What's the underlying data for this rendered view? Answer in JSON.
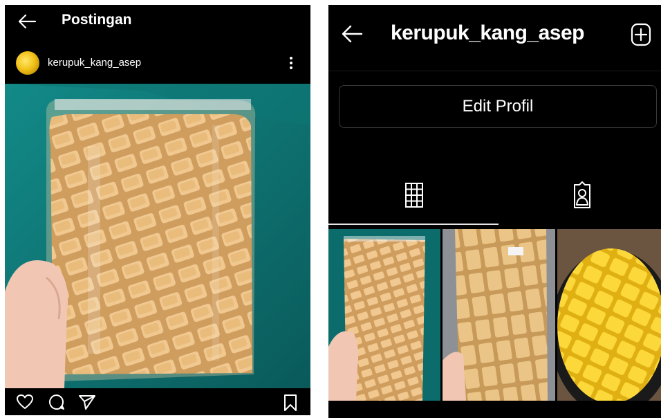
{
  "left": {
    "header": {
      "title": "Postingan"
    },
    "post": {
      "username": "kerupuk_kang_asep"
    },
    "icons": {
      "back": "arrow-left-icon",
      "more": "more-vertical-icon",
      "like": "heart-icon",
      "comment": "comment-icon",
      "share": "send-icon",
      "save": "bookmark-icon"
    }
  },
  "right": {
    "header": {
      "username": "kerupuk_kang_asep"
    },
    "edit_profile_label": "Edit Profil",
    "tabs": [
      {
        "icon": "grid-icon",
        "active": true
      },
      {
        "icon": "tagged-user-icon",
        "active": false
      }
    ],
    "icons": {
      "back": "arrow-left-icon",
      "add": "plus-square-icon"
    }
  },
  "colors": {
    "background": "#000000",
    "foreground": "#ffffff",
    "border": "#3a3a3a",
    "teal_backdrop": "#0c6f6e",
    "cracker": "#e6b878"
  }
}
